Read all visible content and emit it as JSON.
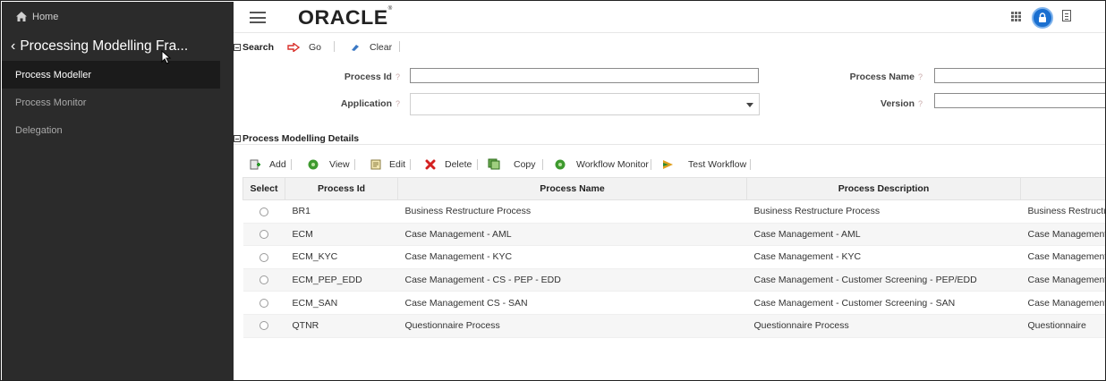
{
  "sidebar": {
    "home_label": "Home",
    "title": "Processing Modelling Fra...",
    "items": [
      {
        "label": "Process Modeller",
        "active": true
      },
      {
        "label": "Process Monitor",
        "active": false
      },
      {
        "label": "Delegation",
        "active": false
      }
    ]
  },
  "header": {
    "logo_text": "ORACLE",
    "logo_mark": "®",
    "icons": [
      "menu-icon",
      "apps-grid-icon",
      "user-avatar-icon",
      "document-icon"
    ]
  },
  "search": {
    "section_label": "Search",
    "go_label": "Go",
    "clear_label": "Clear",
    "fields": {
      "process_id_label": "Process Id",
      "process_id_value": "",
      "process_name_label": "Process Name",
      "process_name_value": "",
      "application_label": "Application",
      "application_value": "",
      "version_label": "Version",
      "version_value": "",
      "help_glyph": "?"
    }
  },
  "details": {
    "section_label": "Process Modelling Details",
    "toolbar": {
      "add": "Add",
      "view": "View",
      "edit": "Edit",
      "delete": "Delete",
      "copy": "Copy",
      "workflow_monitor": "Workflow Monitor",
      "test_workflow": "Test Workflow"
    },
    "columns": [
      "Select",
      "Process Id",
      "Process Name",
      "Process Description",
      ""
    ],
    "rows": [
      {
        "id": "BR1",
        "name": "Business Restructure Process",
        "description": "Business Restructure Process",
        "extra": "Business Restructu"
      },
      {
        "id": "ECM",
        "name": "Case Management - AML",
        "description": "Case Management - AML",
        "extra": "Case Management"
      },
      {
        "id": "ECM_KYC",
        "name": "Case Management - KYC",
        "description": "Case Management - KYC",
        "extra": "Case Management"
      },
      {
        "id": "ECM_PEP_EDD",
        "name": "Case Management - CS - PEP - EDD",
        "description": "Case Management - Customer Screening - PEP/EDD",
        "extra": "Case Management"
      },
      {
        "id": "ECM_SAN",
        "name": "Case Management CS - SAN",
        "description": "Case Management - Customer Screening - SAN",
        "extra": "Case Management"
      },
      {
        "id": "QTNR",
        "name": "Questionnaire Process",
        "description": "Questionnaire Process",
        "extra": "Questionnaire"
      }
    ]
  },
  "colors": {
    "sidebar_bg": "#2b2b2b",
    "sidebar_active_bg": "#1b1b1b",
    "avatar_blue": "#1a6fd0",
    "delete_red": "#d42020",
    "go_arrow_red": "#d9302a"
  }
}
